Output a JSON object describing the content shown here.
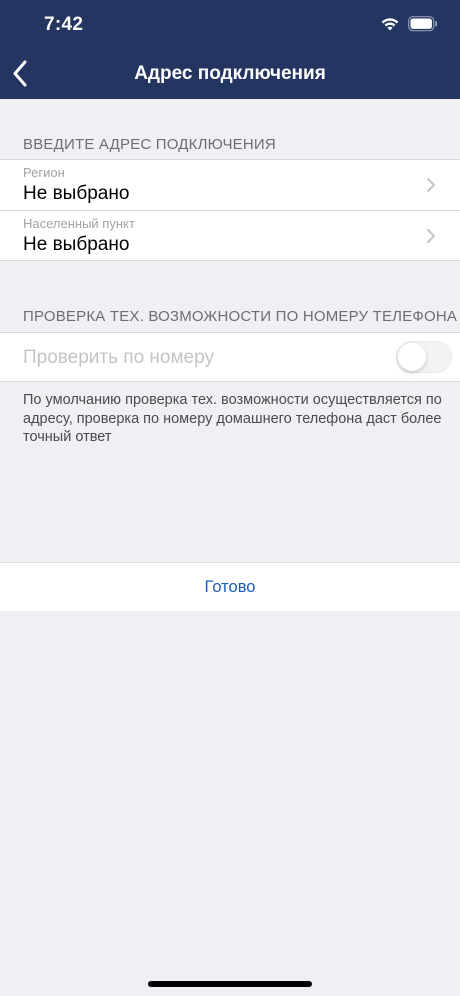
{
  "status_bar": {
    "time": "7:42"
  },
  "nav": {
    "title": "Адрес подключения"
  },
  "address_section": {
    "header": "ВВЕДИТЕ АДРЕС ПОДКЛЮЧЕНИЯ",
    "rows": [
      {
        "label": "Регион",
        "value": "Не выбрано"
      },
      {
        "label": "Населенный пункт",
        "value": "Не выбрано"
      }
    ]
  },
  "phone_section": {
    "header": "ПРОВЕРКА ТЕХ. ВОЗМОЖНОСТИ ПО НОМЕРУ ТЕЛЕФОНА",
    "toggle_label": "Проверить по номеру",
    "toggle_on": false,
    "footer": "По умолчанию проверка тех. возможности осуществляется по адресу, проверка по номеру домашнего телефона даст более точный ответ"
  },
  "done_label": "Готово",
  "colors": {
    "header_bg": "#233560",
    "accent": "#1a5fb4",
    "background": "#efeff4"
  }
}
